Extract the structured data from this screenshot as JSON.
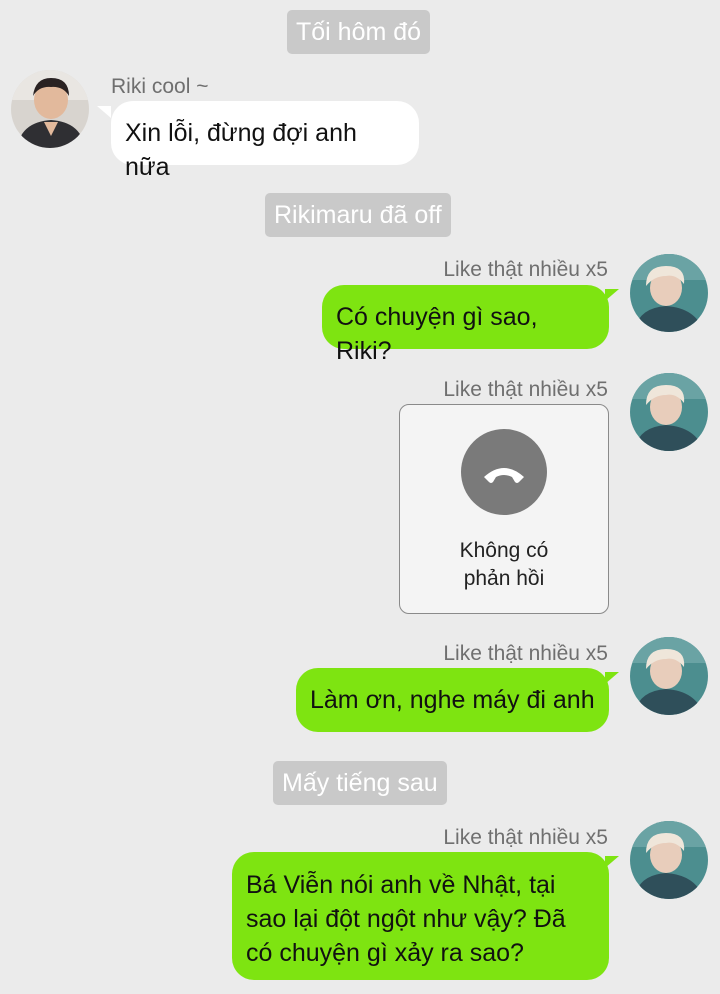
{
  "timeline": {
    "divider_1": "Tối hôm đó",
    "divider_2": "Rikimaru đã off",
    "divider_3": "Mấy tiếng sau"
  },
  "messages": [
    {
      "sender": "Riki cool ~",
      "text": "Xin lỗi, đừng đợi anh nữa",
      "direction": "incoming"
    },
    {
      "sender": "Like thật nhiều x5",
      "text": "Có chuyện gì sao, Riki?",
      "direction": "outgoing"
    },
    {
      "sender": "Like thật nhiều x5",
      "type": "call",
      "call_status_line1": "Không có",
      "call_status_line2": "phản hồi",
      "direction": "outgoing"
    },
    {
      "sender": "Like thật nhiều x5",
      "text": "Làm ơn, nghe máy đi anh",
      "direction": "outgoing"
    },
    {
      "sender": "Like thật nhiều x5",
      "text_line1": "Bá Viễn nói anh về Nhật, tại",
      "text_line2": "sao lại đột ngột như vậy? Đã",
      "text_line3": "có chuyện gì xảy ra sao?",
      "direction": "outgoing"
    }
  ],
  "colors": {
    "background": "#ebebeb",
    "outgoing_bubble": "#7ee411",
    "incoming_bubble": "#ffffff",
    "system_label": "#c9c9c9"
  },
  "icons": {
    "call": "hang-up-phone-icon"
  }
}
